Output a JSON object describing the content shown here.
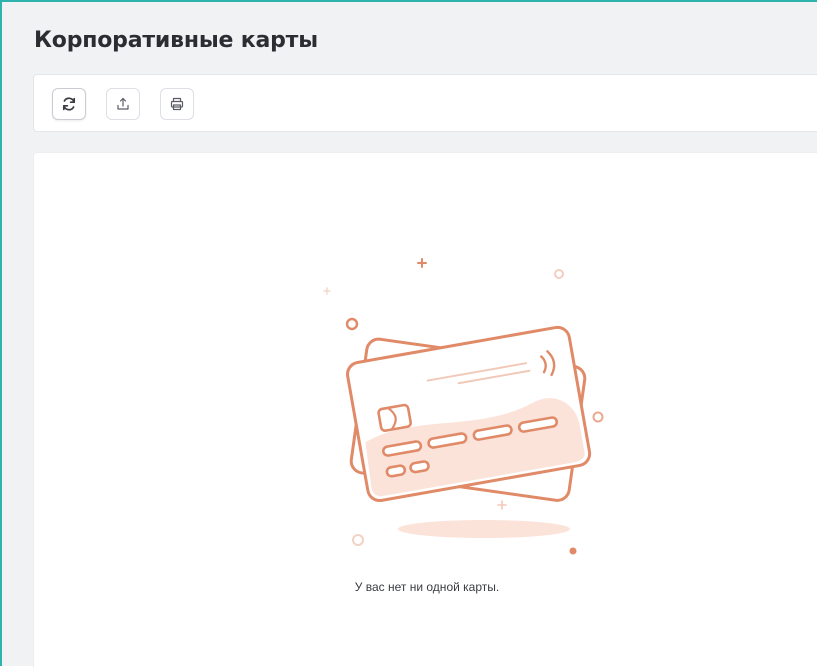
{
  "page": {
    "title": "Корпоративные карты"
  },
  "toolbar": {
    "buttons": [
      {
        "name": "refresh",
        "icon": "refresh-icon"
      },
      {
        "name": "export",
        "icon": "upload-icon"
      },
      {
        "name": "print",
        "icon": "printer-icon"
      }
    ]
  },
  "empty_state": {
    "message": "У вас нет ни одной карты.",
    "illustration": "credit-cards-icon"
  },
  "colors": {
    "accent_border": "#2fb3ad",
    "illustration_stroke": "#e08a68",
    "illustration_fill": "#fbe3da"
  }
}
